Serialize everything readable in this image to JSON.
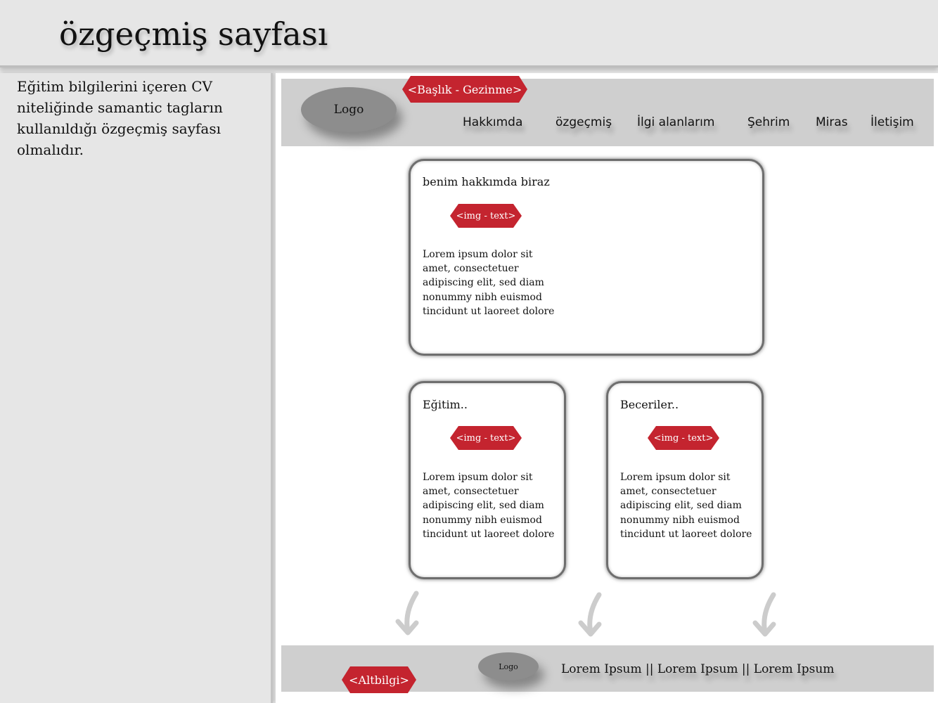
{
  "page_title": "özgeçmiş sayfası",
  "description": "Eğitim bilgilerini içeren CV niteliğinde samantic tagların kullanıldığı özgeçmiş sayfası olmalıdır.",
  "header": {
    "logo_label": "Logo",
    "tag_label": "<Başlık - Gezinme>",
    "nav_items": [
      "Hakkımda",
      "özgeçmiş",
      "İlgi alanlarım",
      "Şehrim",
      "Miras",
      "İletişim"
    ]
  },
  "sections": {
    "about": {
      "title": "benim hakkımda biraz",
      "tag_label": "<img - text>",
      "text": "Lorem ipsum dolor sit amet, consectetuer adipiscing elit, sed diam nonummy nibh euismod tincidunt ut laoreet dolore"
    },
    "education": {
      "title": "Eğitim..",
      "tag_label": "<img - text>",
      "text": "Lorem ipsum dolor sit amet, consectetuer adipiscing elit, sed diam nonummy nibh euismod tincidunt ut laoreet dolore"
    },
    "skills": {
      "title": "Beceriler..",
      "tag_label": "<img - text>",
      "text": "Lorem ipsum dolor sit amet, consectetuer adipiscing elit, sed diam nonummy nibh euismod tincidunt ut laoreet dolore"
    }
  },
  "footer": {
    "tag_label": "<Altbilgi>",
    "logo_label": "Logo",
    "links_text": "Lorem Ipsum || Lorem Ipsum || Lorem Ipsum"
  },
  "colors": {
    "tag_red": "#c4242f",
    "bar_gray": "#cfcfcf",
    "logo_gray": "#8d8d8d",
    "arrow_gray": "#cccccc"
  },
  "icons": [
    "curved-down-arrow-icon"
  ]
}
